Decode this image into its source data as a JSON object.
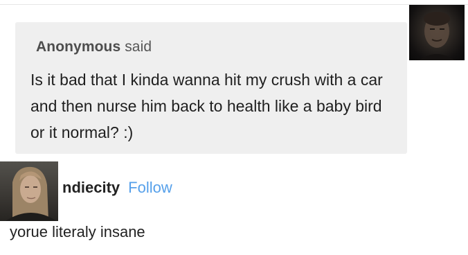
{
  "ask": {
    "asker_name": "Anonymous",
    "asker_verb": "said",
    "question": "Is it bad that I kinda wanna hit my crush with a car and then nurse him back to health like a baby bird or it normal? :)",
    "avatar_icon": "asker-avatar-photo"
  },
  "answer": {
    "username": "ndiecity",
    "follow_label": "Follow",
    "text": "yorue literaly insane",
    "avatar_icon": "answerer-avatar-photo",
    "link_color": "#56a0ea"
  }
}
